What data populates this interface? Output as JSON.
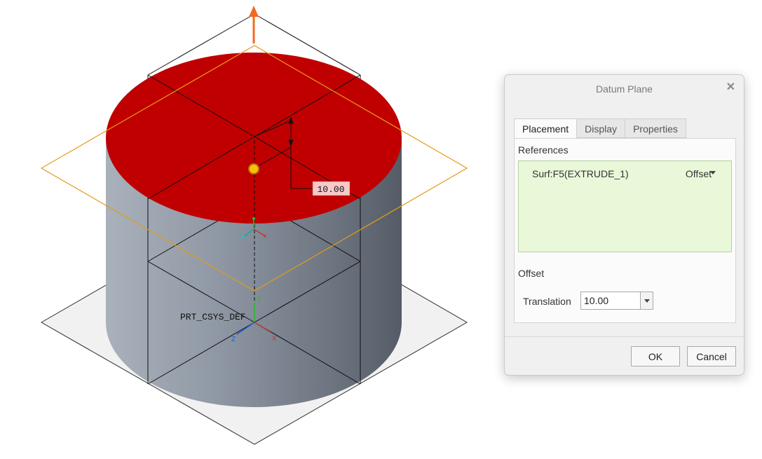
{
  "viewport": {
    "dimension_value": "10.00",
    "csys_label": "PRT_CSYS_DEF",
    "axis_labels": {
      "x": "X",
      "y": "Y",
      "z": "Z"
    },
    "colors": {
      "top_face": "#c00000",
      "cylinder_light": "#a9b1bb",
      "cylinder_dark": "#555c66",
      "datum_plane": "#e59a19",
      "drag_arrow": "#f26a21",
      "dimension_box": "#f7c9c9"
    }
  },
  "dialog": {
    "title": "Datum Plane",
    "close_icon": "close-icon",
    "tabs": [
      "Placement",
      "Display",
      "Properties"
    ],
    "active_tab": "Placement",
    "references_label": "References",
    "reference": {
      "name": "Surf:F5(EXTRUDE_1)",
      "type": "Offset"
    },
    "offset_label": "Offset",
    "translation_label": "Translation",
    "translation_value": "10.00",
    "buttons": {
      "ok": "OK",
      "cancel": "Cancel"
    }
  }
}
